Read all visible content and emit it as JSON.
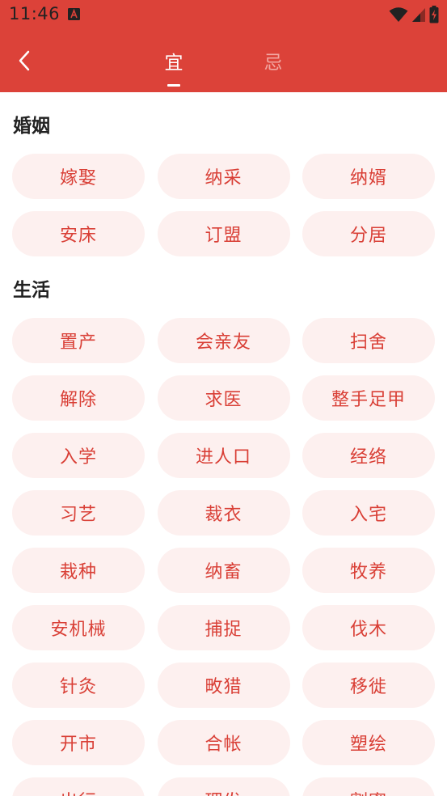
{
  "status_bar": {
    "time": "11:46"
  },
  "header": {
    "tabs": [
      {
        "label": "宜",
        "active": true
      },
      {
        "label": "忌",
        "active": false
      }
    ]
  },
  "colors": {
    "header_bg": "#dc4239",
    "chip_bg": "#fdf0ef",
    "chip_text": "#d93f36"
  },
  "sections": [
    {
      "title": "婚姻",
      "items": [
        "嫁娶",
        "纳采",
        "纳婿",
        "安床",
        "订盟",
        "分居"
      ]
    },
    {
      "title": "生活",
      "items": [
        "置产",
        "会亲友",
        "扫舍",
        "解除",
        "求医",
        "整手足甲",
        "入学",
        "进人口",
        "经络",
        "习艺",
        "裁衣",
        "入宅",
        "栽种",
        "纳畜",
        "牧养",
        "安机械",
        "捕捉",
        "伐木",
        "针灸",
        "畋猎",
        "移徙",
        "开市",
        "合帐",
        "塑绘",
        "出行",
        "理发",
        "割蜜"
      ]
    }
  ]
}
